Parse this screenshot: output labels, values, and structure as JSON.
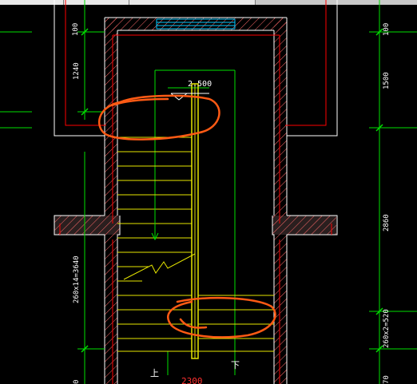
{
  "tabs": [
    {
      "label": ""
    },
    {
      "label": ""
    },
    {
      "label": ""
    }
  ],
  "colors": {
    "background": "#000000",
    "wall": "#ffffff",
    "hatch": "#ff6a6a",
    "dimension": "#00e000",
    "stairs": "#e6e600",
    "redline": "#ff0000",
    "window": "#00c8ff",
    "annotation": "#ff5a14"
  },
  "labels": {
    "elevation": "2.500",
    "dim_100_left": "100",
    "dim_1240": "1240",
    "dim_stair_left": "260x14=3640",
    "dim_100_right": "100",
    "dim_1500": "1500",
    "dim_2860": "2860",
    "dim_stair_right": "260x2=520",
    "dim_bottom_right": "70",
    "dim_bottom_left": "0",
    "up": "上",
    "down": "下",
    "width": "2300"
  }
}
